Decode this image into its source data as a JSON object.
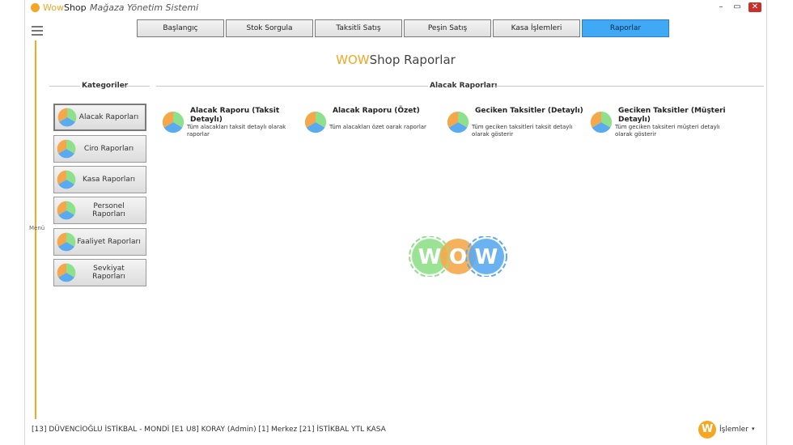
{
  "titlebar": {
    "app_name_highlight": "Wow",
    "app_name_rest": "Shop",
    "separator": "-",
    "subtitle": "Mağaza Yönetim Sistemi",
    "minimize": "–",
    "maximize": "▭",
    "close": "✕"
  },
  "sidebar": {
    "menu_label": "Menü"
  },
  "top_tabs": [
    {
      "label": "Başlangıç"
    },
    {
      "label": "Stok Sorgula"
    },
    {
      "label": "Taksitli Satış"
    },
    {
      "label": "Peşin Satış"
    },
    {
      "label": "Kasa İşlemleri"
    },
    {
      "label": "Raporlar"
    }
  ],
  "active_tab": "Raporlar",
  "brand": {
    "highlight": "WOW",
    "rest": "Shop Raporlar"
  },
  "categories": {
    "header": "Kategoriler",
    "items": [
      {
        "label": "Alacak Raporları"
      },
      {
        "label": "Ciro Raporları"
      },
      {
        "label": "Kasa Raporları"
      },
      {
        "label": "Personel Raporları"
      },
      {
        "label": "Faaliyet Raporları"
      },
      {
        "label": "Sevkiyat Raporları"
      }
    ]
  },
  "reports": {
    "header": "Alacak Raporları",
    "items": [
      {
        "title": "Alacak Raporu (Taksit Detaylı)",
        "desc": "Tüm alacakları taksit detaylı olarak raporlar"
      },
      {
        "title": "Alacak Raporu (Özet)",
        "desc": "Tüm alacakları özet oarak raporlar"
      },
      {
        "title": "Geciken Taksitler (Detaylı)",
        "desc": "Tüm geciken taksitleri taksit detaylı olarak gösterir"
      },
      {
        "title": "Geciken Taksitler (Müşteri Detaylı)",
        "desc": "Tüm geciken taksiteri müşteri detaylı olarak gösterir"
      }
    ]
  },
  "logo_letters": [
    "W",
    "O",
    "W"
  ],
  "status": {
    "text": "[13] DÜVENCİOĞLU İSTİKBAL - MONDİ   [E1 U8] KORAY  (Admin)  [1] Merkez  [21] İSTİKBAL YTL KASA",
    "badge": "W",
    "menu_label": "İşlemler",
    "arrow": "▾"
  },
  "colors": {
    "accent": "#f5a623",
    "active_tab": "#3fa9f5",
    "pie_orange": "#f5a84a",
    "pie_green": "#8fe08a",
    "pie_blue": "#5aaaf0"
  }
}
